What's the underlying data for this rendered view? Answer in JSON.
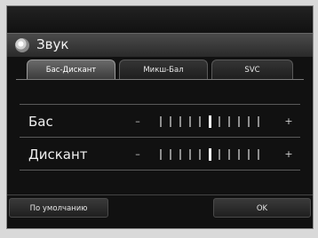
{
  "header": {
    "title": "Звук",
    "icon": "sound-settings-icon"
  },
  "tabs": [
    {
      "label": "Бас-Дискант",
      "active": true
    },
    {
      "label": "Микш-Бал",
      "active": false
    },
    {
      "label": "SVC",
      "active": false
    }
  ],
  "controls": [
    {
      "label": "Бас",
      "minus": "–",
      "plus": "+",
      "level": 0,
      "range": [
        -5,
        5
      ]
    },
    {
      "label": "Дискант",
      "minus": "–",
      "plus": "+",
      "level": 0,
      "range": [
        -5,
        5
      ]
    }
  ],
  "buttons": {
    "default_label": "По умолчанию",
    "ok_label": "OK"
  },
  "colors": {
    "background": "#111111",
    "accent": "#ffffff",
    "text": "#f0f0f0"
  }
}
